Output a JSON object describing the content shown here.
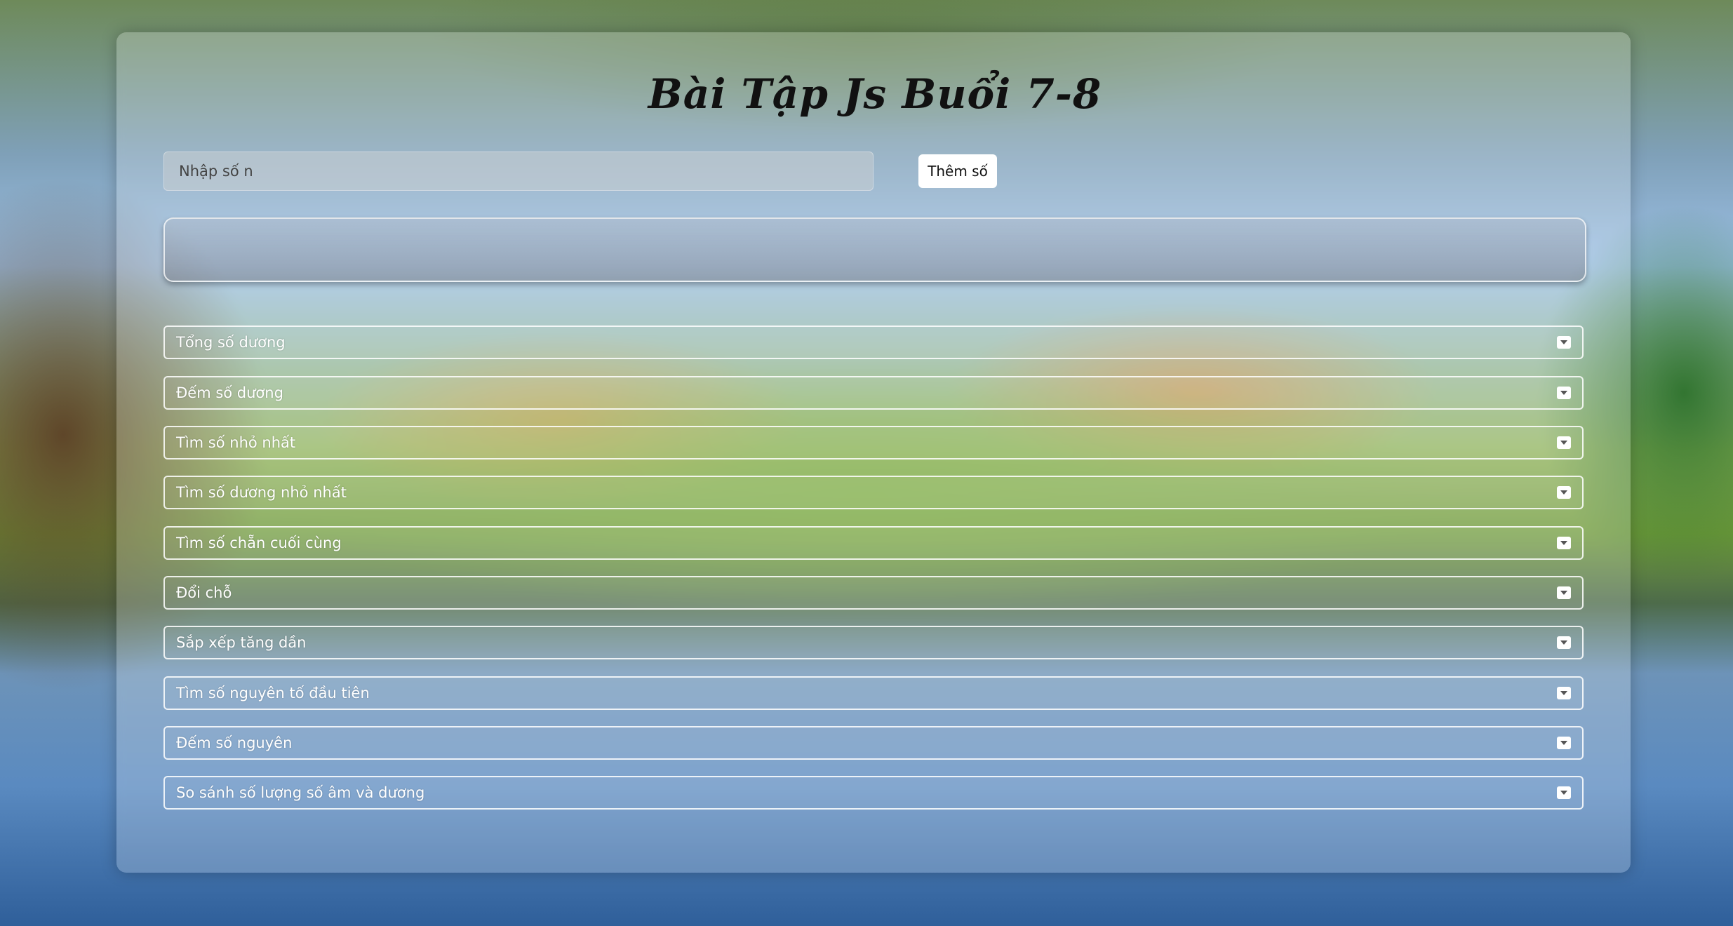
{
  "page": {
    "title": "Bài Tập Js Buổi 7-8"
  },
  "input": {
    "placeholder": "Nhập số n",
    "value": ""
  },
  "add_button": {
    "label": "Thêm số"
  },
  "result": {
    "text": ""
  },
  "accordion": {
    "icon": "caret-down-square-icon",
    "items": [
      {
        "label": "Tổng số dương"
      },
      {
        "label": "Đếm số dương"
      },
      {
        "label": "Tìm số nhỏ nhất"
      },
      {
        "label": "Tìm số dương nhỏ nhất"
      },
      {
        "label": "Tìm số chẵn cuối cùng"
      },
      {
        "label": "Đổi chỗ"
      },
      {
        "label": "Sắp xếp tăng dần"
      },
      {
        "label": "Tìm số nguyên tố đầu tiên"
      },
      {
        "label": "Đếm số nguyên"
      },
      {
        "label": "So sánh số lượng số âm và dương"
      }
    ]
  }
}
